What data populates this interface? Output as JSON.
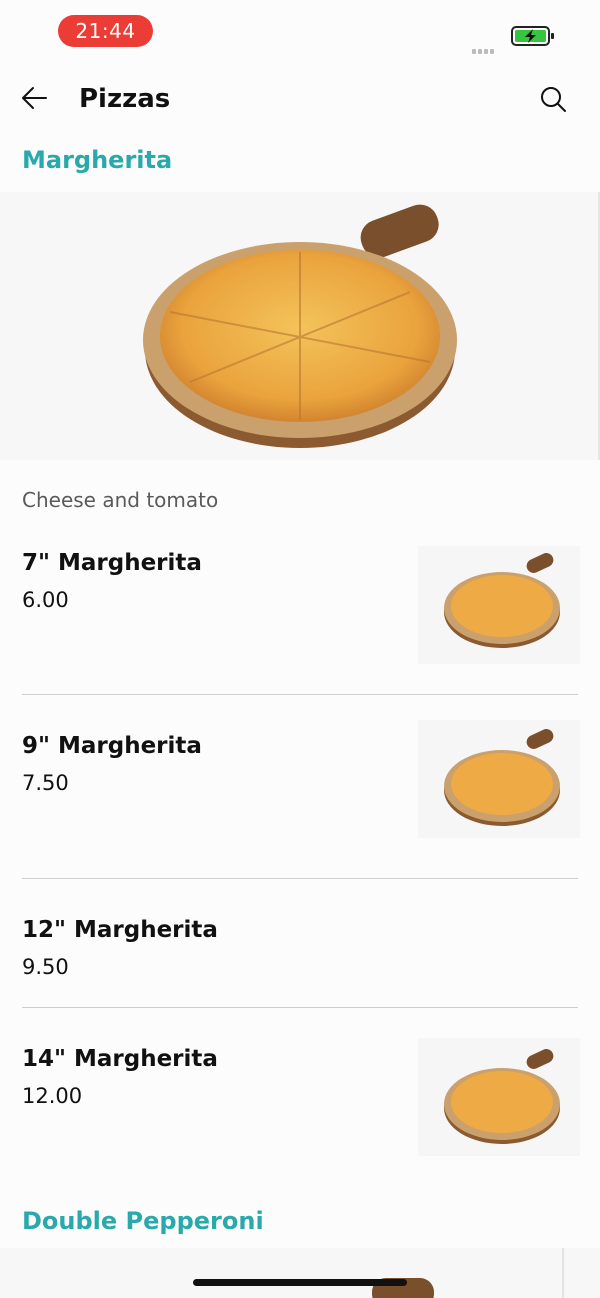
{
  "status_bar": {
    "time": "21:44"
  },
  "header": {
    "title": "Pizzas"
  },
  "sections": [
    {
      "title": "Margherita",
      "description": "Cheese and tomato",
      "items": [
        {
          "name": "7\" Margherita",
          "price": "6.00"
        },
        {
          "name": "9\" Margherita",
          "price": "7.50"
        },
        {
          "name": "12\" Margherita",
          "price": "9.50"
        },
        {
          "name": "14\" Margherita",
          "price": "12.00"
        }
      ]
    },
    {
      "title": "Double Pepperoni"
    }
  ],
  "colors": {
    "accent": "#2aa9ac",
    "time_pill": "#eb3c35",
    "battery": "#37c43f"
  },
  "icons": {
    "back": "arrow-left-icon",
    "search": "magnifier-icon",
    "battery": "battery-charging-icon",
    "signal": "signal-dots-icon"
  }
}
